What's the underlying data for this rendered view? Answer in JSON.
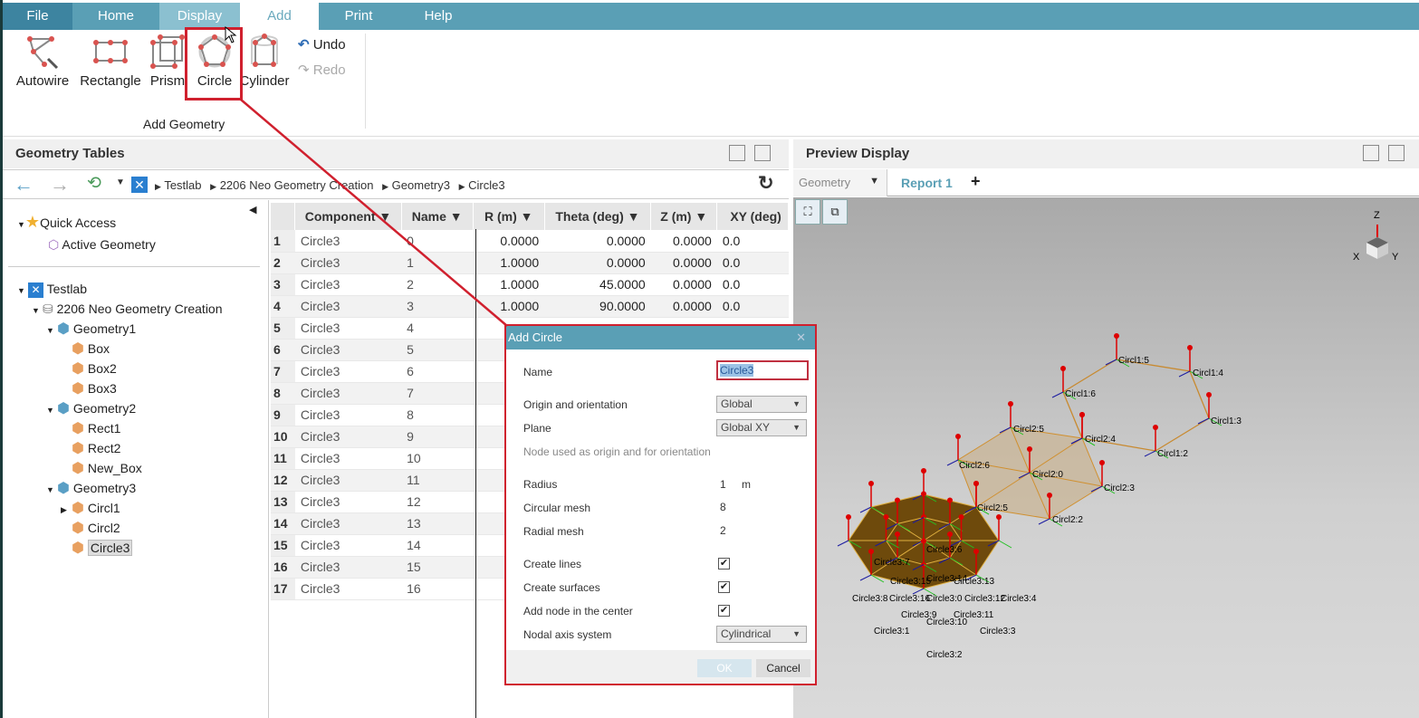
{
  "tabs": [
    "File",
    "Home",
    "Display",
    "Add",
    "Print",
    "Help"
  ],
  "ribbon": {
    "buttons": [
      "Autowire",
      "Rectangle",
      "Prism",
      "Circle",
      "Cylinder"
    ],
    "undo": "Undo",
    "redo": "Redo",
    "group": "Add Geometry"
  },
  "geometry_tables": {
    "title": "Geometry Tables",
    "breadcrumb": [
      "Testlab",
      "2206 Neo Geometry Creation",
      "Geometry3",
      "Circle3"
    ]
  },
  "tree": {
    "quick_access": "Quick Access",
    "active_geometry": "Active Geometry",
    "items": [
      {
        "label": "Testlab",
        "level": 0
      },
      {
        "label": "2206 Neo Geometry Creation",
        "level": 1
      },
      {
        "label": "Geometry1",
        "level": 2
      },
      {
        "label": "Box",
        "level": 3
      },
      {
        "label": "Box2",
        "level": 3
      },
      {
        "label": "Box3",
        "level": 3
      },
      {
        "label": "Geometry2",
        "level": 2
      },
      {
        "label": "Rect1",
        "level": 3
      },
      {
        "label": "Rect2",
        "level": 3
      },
      {
        "label": "New_Box",
        "level": 3
      },
      {
        "label": "Geometry3",
        "level": 2
      },
      {
        "label": "Circl1",
        "level": 3
      },
      {
        "label": "Circl2",
        "level": 3
      },
      {
        "label": "Circle3",
        "level": 3,
        "selected": true
      }
    ]
  },
  "table": {
    "columns": [
      "Component",
      "Name",
      "R (m)",
      "Theta (deg)",
      "Z (m)",
      "XY (deg)"
    ],
    "rows": [
      [
        "1",
        "Circle3",
        "0",
        "0.0000",
        "0.0000",
        "0.0000",
        "0.0"
      ],
      [
        "2",
        "Circle3",
        "1",
        "1.0000",
        "0.0000",
        "0.0000",
        "0.0"
      ],
      [
        "3",
        "Circle3",
        "2",
        "1.0000",
        "45.0000",
        "0.0000",
        "0.0"
      ],
      [
        "4",
        "Circle3",
        "3",
        "1.0000",
        "90.0000",
        "0.0000",
        "0.0"
      ],
      [
        "5",
        "Circle3",
        "4"
      ],
      [
        "6",
        "Circle3",
        "5"
      ],
      [
        "7",
        "Circle3",
        "6"
      ],
      [
        "8",
        "Circle3",
        "7"
      ],
      [
        "9",
        "Circle3",
        "8"
      ],
      [
        "10",
        "Circle3",
        "9"
      ],
      [
        "11",
        "Circle3",
        "10"
      ],
      [
        "12",
        "Circle3",
        "11"
      ],
      [
        "13",
        "Circle3",
        "12"
      ],
      [
        "14",
        "Circle3",
        "13"
      ],
      [
        "15",
        "Circle3",
        "14"
      ],
      [
        "16",
        "Circle3",
        "15"
      ],
      [
        "17",
        "Circle3",
        "16"
      ]
    ]
  },
  "preview": {
    "title": "Preview Display",
    "view_select": "Geometry",
    "tab": "Report 1",
    "add": "+",
    "axes": {
      "z": "Z",
      "x": "X",
      "y": "Y"
    },
    "labels": [
      "Circl1:5",
      "Circl1:4",
      "Circl1:6",
      "Circl1:3",
      "Circl1:2",
      "Circl2:5",
      "Circl2:4",
      "Circl2:6",
      "Circl2:0",
      "Circl2:3",
      "Circl2:2",
      "Circl2:5",
      "Circle3:6",
      "Circle3:7",
      "Circle3:14",
      "Circle3:15",
      "Circle3:13",
      "Circle3:8",
      "Circle3:16",
      "Circle3:0",
      "Circle3:12",
      "Circle3:4",
      "Circle3:9",
      "Circle3:11",
      "Circle3:10",
      "Circle3:1",
      "Circle3:3",
      "Circle3:2"
    ]
  },
  "dialog": {
    "title": "Add Circle",
    "name_label": "Name",
    "name_value": "Circle3",
    "origin_label": "Origin and orientation",
    "origin_value": "Global",
    "plane_label": "Plane",
    "plane_value": "Global XY",
    "node_hint": "Node used as origin and for orientation",
    "radius_label": "Radius",
    "radius_value": "1",
    "radius_unit": "m",
    "circ_label": "Circular mesh",
    "circ_value": "8",
    "radial_label": "Radial mesh",
    "radial_value": "2",
    "lines_label": "Create lines",
    "lines_checked": true,
    "surf_label": "Create surfaces",
    "surf_checked": true,
    "center_label": "Add node in the center",
    "center_checked": true,
    "axis_label": "Nodal axis system",
    "axis_value": "Cylindrical",
    "ok": "OK",
    "cancel": "Cancel"
  },
  "colors": {
    "accent": "#5a9fb5",
    "highlight": "#d0202e"
  }
}
